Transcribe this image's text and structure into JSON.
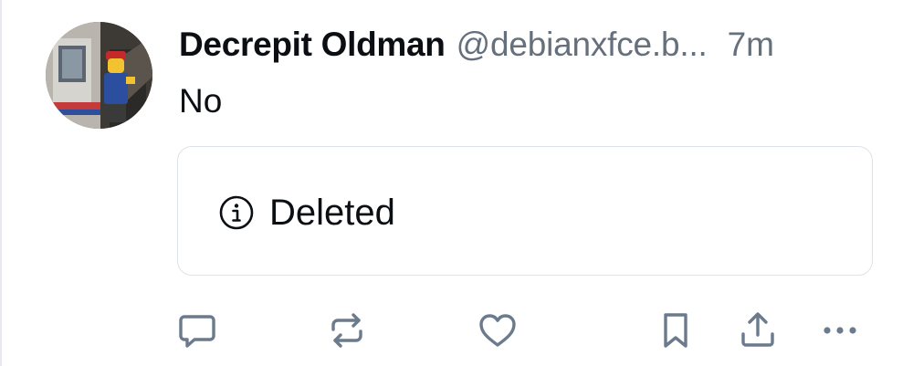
{
  "post": {
    "author": {
      "display_name": "Decrepit Oldman",
      "handle": "@debianxfce.b..."
    },
    "timestamp": "7m",
    "text": "No",
    "embed": {
      "icon": "info-circle-icon",
      "label": "Deleted"
    },
    "actions": [
      {
        "name": "reply",
        "icon": "speech-bubble-icon"
      },
      {
        "name": "repost",
        "icon": "repost-icon"
      },
      {
        "name": "like",
        "icon": "heart-icon"
      },
      {
        "name": "bookmark",
        "icon": "bookmark-icon"
      },
      {
        "name": "share",
        "icon": "share-icon"
      },
      {
        "name": "more",
        "icon": "more-dots-icon"
      }
    ]
  },
  "colors": {
    "text": "#0b0f14",
    "muted": "#66707c",
    "icon": "#6b7a8c",
    "border": "#dde3e9"
  }
}
